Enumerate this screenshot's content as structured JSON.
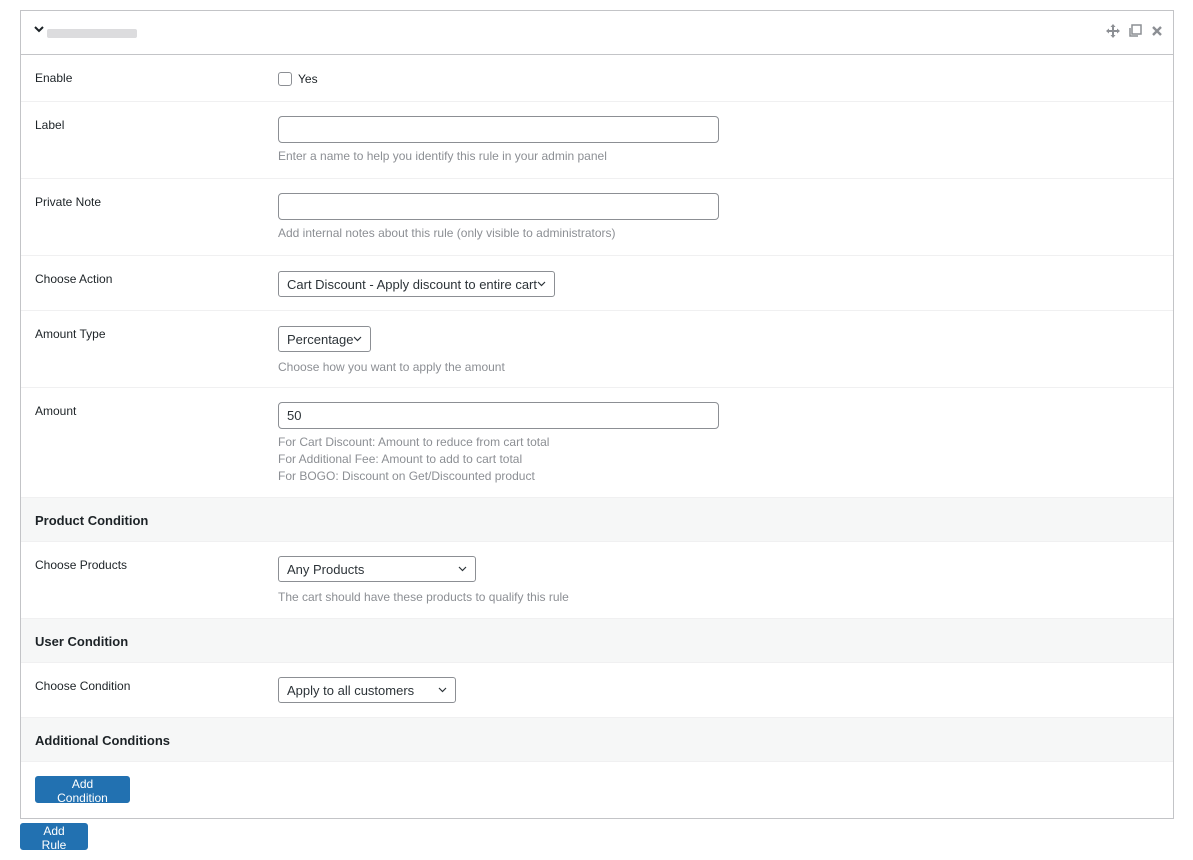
{
  "header": {
    "title_redacted": true,
    "icons": [
      "move-icon",
      "duplicate-icon",
      "close-icon"
    ]
  },
  "fields": {
    "enable": {
      "label": "Enable",
      "checkbox_label": "Yes",
      "checked": false
    },
    "label": {
      "label": "Label",
      "value": "",
      "placeholder": "",
      "description": "Enter a name to help you identify this rule in your admin panel"
    },
    "private_note": {
      "label": "Private Note",
      "value": "",
      "placeholder": "",
      "description": "Add internal notes about this rule (only visible to administrators)"
    },
    "choose_action": {
      "label": "Choose Action",
      "selected": "Cart Discount - Apply discount to entire cart"
    },
    "amount_type": {
      "label": "Amount Type",
      "selected": "Percentage",
      "description": "Choose how you want to apply the amount"
    },
    "amount": {
      "label": "Amount",
      "value": "50",
      "description_lines": [
        "For Cart Discount: Amount to reduce from cart total",
        "For Additional Fee: Amount to add to cart total",
        "For BOGO: Discount on Get/Discounted product"
      ]
    }
  },
  "sections": {
    "product_condition": {
      "title": "Product Condition",
      "choose_products": {
        "label": "Choose Products",
        "selected": "Any Products",
        "description": "The cart should have these products to qualify this rule"
      }
    },
    "user_condition": {
      "title": "User Condition",
      "choose_condition": {
        "label": "Choose Condition",
        "selected": "Apply to all customers"
      }
    },
    "additional_conditions": {
      "title": "Additional Conditions",
      "add_condition_label": "Add Condition"
    }
  },
  "footer": {
    "add_rule_label": "Add Rule"
  },
  "colors": {
    "primary_button": "#2271b1",
    "section_bg": "#f6f7f7",
    "border": "#c3c4c7",
    "muted_text": "#8c8f94"
  }
}
